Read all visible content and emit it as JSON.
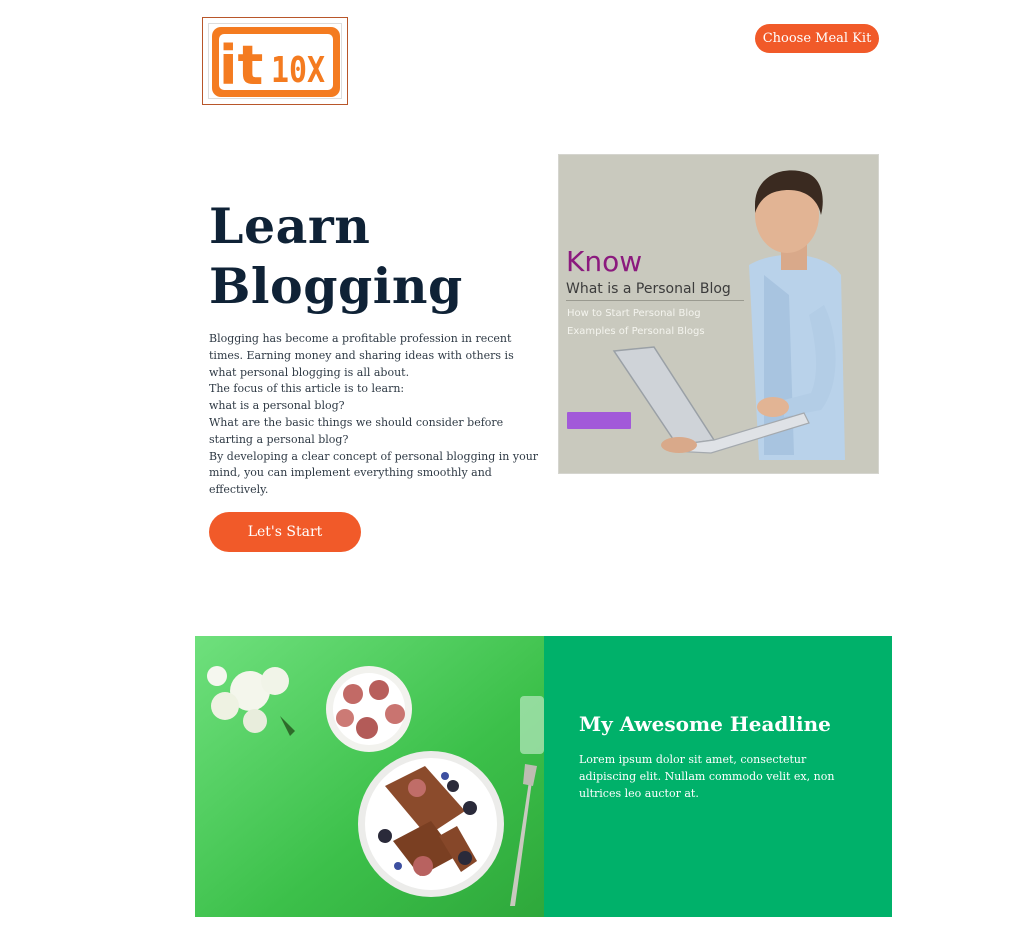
{
  "header": {
    "logo_text_it": "it",
    "logo_text_10x": "10X",
    "cta_label": "Choose Meal Kit"
  },
  "hero": {
    "title": "Learn Blogging",
    "paragraphs": [
      "Blogging has become a profitable profession in recent times. Earning money and sharing ideas with others is what personal blogging is all about.",
      "The focus of this article is to learn:",
      "what is a personal blog?",
      "What are the basic things we should consider before starting a personal blog?",
      "By developing a clear concept of personal blogging in your mind, you can implement everything smoothly and effectively."
    ],
    "button_label": "Let's Start",
    "image": {
      "heading": "Know",
      "subheading": "What is a Personal Blog",
      "item1": "How to Start Personal Blog",
      "item2": "Examples of Personal Blogs"
    }
  },
  "feature": {
    "title": "My Awesome Headline",
    "text": "Lorem ipsum dolor sit amet, consectetur adipiscing elit. Nullam commodo velit ex, non ultrices leo auctor at."
  },
  "colors": {
    "accent": "#f15a29",
    "title": "#0f2236",
    "panel": "#00b16a",
    "logo_orange": "#f47b20"
  }
}
